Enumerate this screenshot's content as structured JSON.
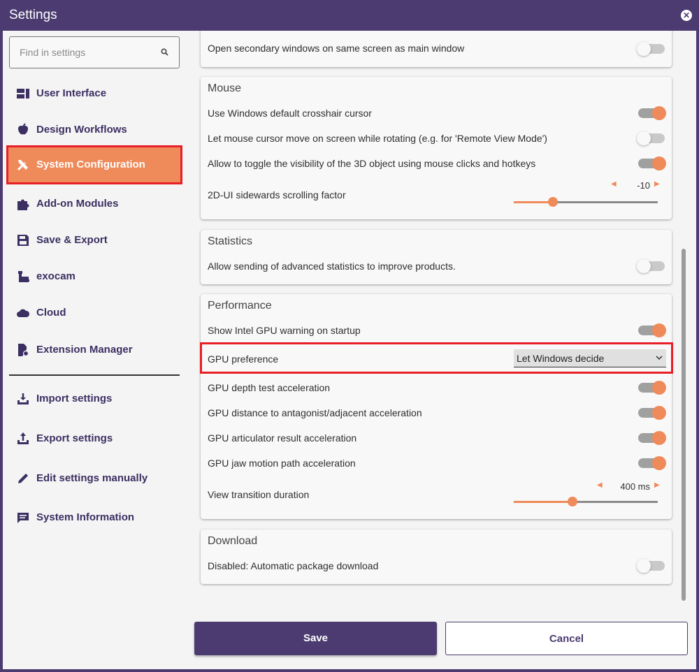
{
  "window": {
    "title": "Settings"
  },
  "search": {
    "placeholder": "Find in settings"
  },
  "sidebar": {
    "items": [
      {
        "label": "User Interface",
        "icon": "user-interface-icon"
      },
      {
        "label": "Design Workflows",
        "icon": "design-workflows-icon"
      },
      {
        "label": "System Configuration",
        "icon": "tools-icon",
        "active": true
      },
      {
        "label": "Add-on Modules",
        "icon": "puzzle-icon"
      },
      {
        "label": "Save & Export",
        "icon": "floppy-icon"
      },
      {
        "label": "exocam",
        "icon": "exocam-icon"
      },
      {
        "label": "Cloud",
        "icon": "cloud-icon"
      },
      {
        "label": "Extension Manager",
        "icon": "extension-manager-icon"
      }
    ],
    "bottom_items": [
      {
        "label": "Import settings",
        "icon": "import-icon"
      },
      {
        "label": "Export settings",
        "icon": "export-icon"
      },
      {
        "label": "Edit settings manually",
        "icon": "pencil-icon"
      },
      {
        "label": "System Information",
        "icon": "message-icon"
      }
    ]
  },
  "sections": {
    "top": {
      "rows": [
        {
          "label": "Open secondary windows on same screen as main window",
          "value": false
        }
      ]
    },
    "mouse": {
      "title": "Mouse",
      "rows": [
        {
          "label": "Use Windows default crosshair cursor",
          "value": true
        },
        {
          "label": "Let mouse cursor move on screen while rotating (e.g. for 'Remote View Mode')",
          "value": false
        },
        {
          "label": "Allow to toggle the visibility of the 3D object using mouse clicks and hotkeys",
          "value": true
        }
      ],
      "slider": {
        "label": "2D-UI sidewards scrolling factor",
        "value": "-10",
        "fraction": 0.27
      }
    },
    "statistics": {
      "title": "Statistics",
      "rows": [
        {
          "label": "Allow sending of advanced statistics to improve products.",
          "value": false
        }
      ]
    },
    "performance": {
      "title": "Performance",
      "rows": [
        {
          "label": "Show Intel GPU warning on startup",
          "value": true
        }
      ],
      "gpu_preference": {
        "label": "GPU preference",
        "selected": "Let Windows decide"
      },
      "rows2": [
        {
          "label": "GPU depth test acceleration",
          "value": true
        },
        {
          "label": "GPU distance to antagonist/adjacent acceleration",
          "value": true
        },
        {
          "label": "GPU articulator result acceleration",
          "value": true
        },
        {
          "label": "GPU jaw motion path acceleration",
          "value": true
        }
      ],
      "slider": {
        "label": "View transition duration",
        "value": "400 ms",
        "fraction": 0.41
      }
    },
    "download": {
      "title": "Download",
      "rows": [
        {
          "label": "Disabled:  Automatic package download",
          "value": false
        }
      ]
    }
  },
  "footer": {
    "save_label": "Save",
    "cancel_label": "Cancel"
  },
  "colors": {
    "brand": "#4b3b70",
    "accent": "#ef8a5a",
    "highlight": "#e81f26"
  }
}
